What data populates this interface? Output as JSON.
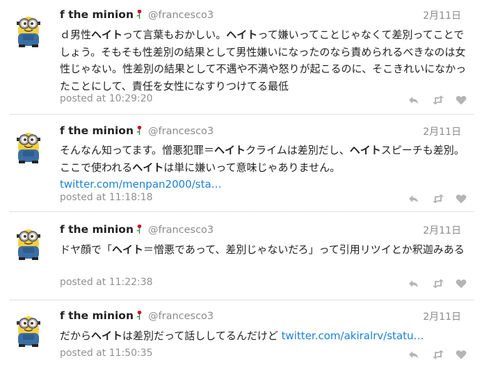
{
  "tweets": [
    {
      "name": "f the minion",
      "handle": "@francesco3",
      "date": "2月11日",
      "segments": [
        {
          "t": "ｄ男性",
          "s": "n"
        },
        {
          "t": "ヘイト",
          "s": "b"
        },
        {
          "t": "って言葉もおかしい。",
          "s": "n"
        },
        {
          "t": "ヘイト",
          "s": "b"
        },
        {
          "t": "って嫌いってことじゃなくて差別ってことでしょう。そもそも性差別の結果として男性嫌いになったのなら責められるべきなのは女性じゃない。性差別の結果として不遇や不満や怒りが起こるのに、そこきれいになかったことにして、責任を女性になすりつけてる最低",
          "s": "n"
        }
      ],
      "posted": "posted at 10:29:20"
    },
    {
      "name": "f the minion",
      "handle": "@francesco3",
      "date": "2月11日",
      "segments": [
        {
          "t": "そんなん知ってます。憎悪犯罪＝",
          "s": "n"
        },
        {
          "t": "ヘイト",
          "s": "b"
        },
        {
          "t": "クライムは差別だし、",
          "s": "n"
        },
        {
          "t": "ヘイト",
          "s": "b"
        },
        {
          "t": "スピーチも差別。ここで使われる",
          "s": "n"
        },
        {
          "t": "ヘイト",
          "s": "b"
        },
        {
          "t": "は単に嫌いって意味じゃありません。 ",
          "s": "n"
        },
        {
          "t": "twitter.com/menpan2000/sta…",
          "s": "l"
        }
      ],
      "posted": "posted at 11:18:18"
    },
    {
      "name": "f the minion",
      "handle": "@francesco3",
      "date": "2月11日",
      "segments": [
        {
          "t": "ドヤ顔で「",
          "s": "n"
        },
        {
          "t": "ヘイト",
          "s": "b"
        },
        {
          "t": "＝憎悪であって、差別じゃないだろ」って引用リツイとか釈迦みある",
          "s": "n"
        }
      ],
      "posted": "posted at 11:22:38"
    },
    {
      "name": "f the minion",
      "handle": "@francesco3",
      "date": "2月11日",
      "segments": [
        {
          "t": "だから",
          "s": "n"
        },
        {
          "t": "ヘイト",
          "s": "b"
        },
        {
          "t": "は差別だって話ししてるんだけど ",
          "s": "n"
        },
        {
          "t": "twitter.com/akiralrv/statu…",
          "s": "l"
        }
      ],
      "posted": "posted at 11:50:35"
    }
  ],
  "icons": [
    "avatar-minion",
    "rose-icon",
    "reply-icon",
    "retweet-icon",
    "like-icon"
  ],
  "colors": {
    "link": "#1a7fd4",
    "muted": "#8a8a8a",
    "rose": "#c8102e"
  }
}
